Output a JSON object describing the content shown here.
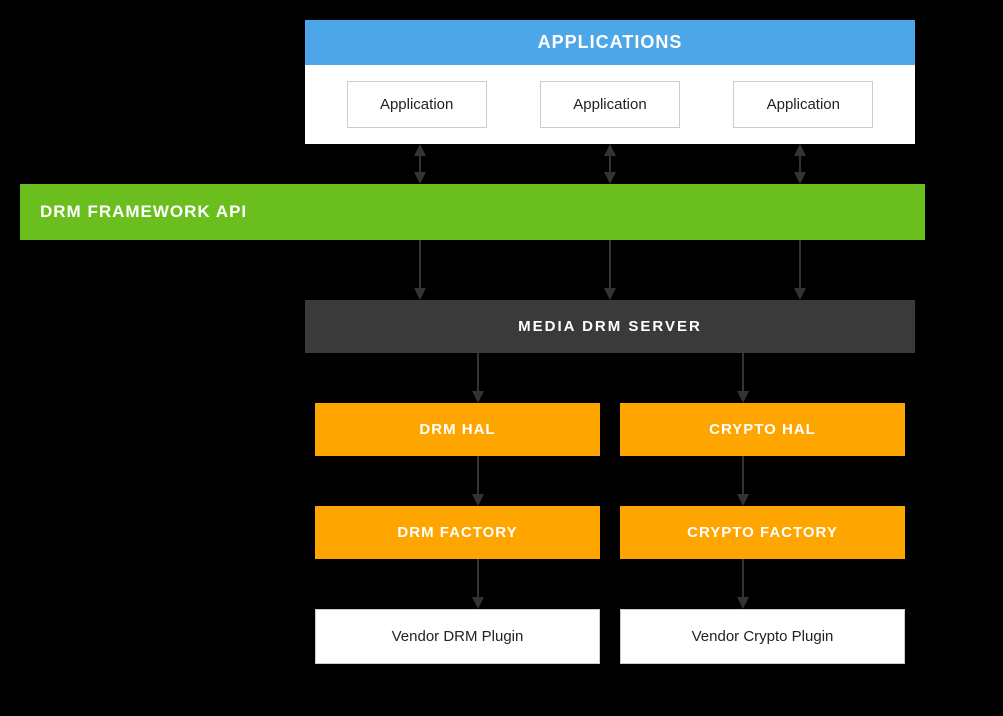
{
  "applications": {
    "header": "APPLICATIONS",
    "boxes": [
      "Application",
      "Application",
      "Application"
    ]
  },
  "drm_framework": {
    "label": "DRM FRAMEWORK API"
  },
  "media_drm_server": {
    "label": "MEDIA DRM SERVER"
  },
  "hal_row": {
    "items": [
      "DRM HAL",
      "CRYPTO HAL"
    ]
  },
  "factory_row": {
    "items": [
      "DRM FACTORY",
      "CRYPTO FACTORY"
    ]
  },
  "plugin_row": {
    "items": [
      "Vendor DRM Plugin",
      "Vendor Crypto Plugin"
    ]
  },
  "colors": {
    "app_header_bg": "#4da6e8",
    "drm_framework_bg": "#6abf1e",
    "media_drm_server_bg": "#3a3a3a",
    "hal_bg": "#ffa500",
    "factory_bg": "#ffa500",
    "plugin_bg": "#ffffff"
  }
}
